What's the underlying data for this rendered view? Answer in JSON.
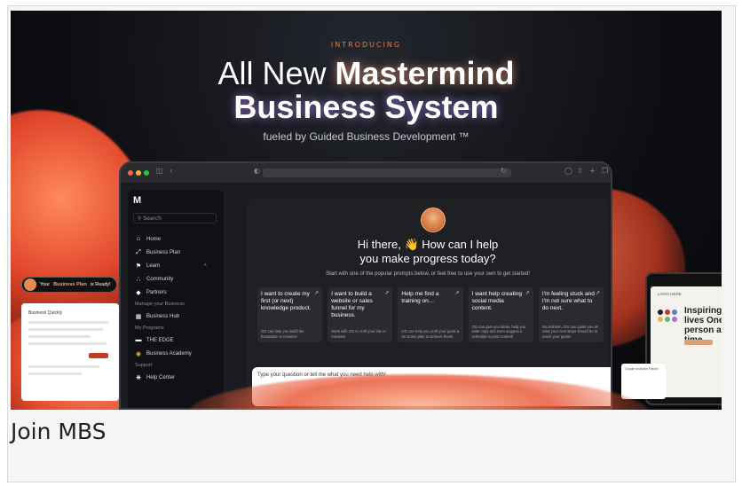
{
  "hero": {
    "introducing": "INTRODUCING",
    "title_line1_light": "All New ",
    "title_line1_bold": "Mastermind",
    "title_line2": "Business System",
    "tagline": "fueled by Guided Business Development ™"
  },
  "app": {
    "search_placeholder": "Search",
    "nav": [
      {
        "label": "Home",
        "icon": "home-icon",
        "glyph": "⌂"
      },
      {
        "label": "Business Plan",
        "icon": "expand-icon",
        "glyph": "⤢"
      },
      {
        "label": "Learn",
        "icon": "graduation-cap-icon",
        "glyph": "⚑"
      },
      {
        "label": "Community",
        "icon": "people-icon",
        "glyph": "∴"
      },
      {
        "label": "Partners",
        "icon": "diamond-icon",
        "glyph": "◆"
      }
    ],
    "section_manage": "Manage your Business",
    "business_hub": "Business Hub",
    "section_programs": "My Programs",
    "program_edge": "THE EDGE",
    "program_academy": "Business Academy",
    "section_support": "Support",
    "help_center": "Help Center",
    "greeting_line1": "Hi there, 👋 How can I help",
    "greeting_line2": "you make progress today?",
    "subtext": "Start with one of the popular prompts below, or feel free to use your own to get started!",
    "prompts": [
      {
        "title": "I want to create my first (or next) knowledge product.",
        "desc": "GG can help you build the foundation in minutes!"
      },
      {
        "title": "I want to build a website or sales funnel for my business.",
        "desc": "Work with GG to craft your site in minutes!"
      },
      {
        "title": "Help me find a training on…",
        "desc": "GG can help you craft your goals & an action plan to achieve them!"
      },
      {
        "title": "I want help creating social media content.",
        "desc": "GG can give you ideas, help you write copy and even suggest a schedule to post content!"
      },
      {
        "title": "I'm feeling stuck and I'm not sure what to do next.",
        "desc": "No problem, GG can guide you on what your next steps should be to reach your goals!"
      }
    ],
    "chat_placeholder": "Type your question or tell me what you need help with!"
  },
  "floating": {
    "pill_prefix": "Your ",
    "pill_bold": "Business Plan",
    "pill_suffix": " is Ready!",
    "left_doc_title": "Business Quickly",
    "tablet_logo": "LOGO HERE",
    "tablet_heading": "Inspiring lives One person at a time.",
    "tablet_card_title": "Google Analytics Report"
  },
  "caption": "Join MBS",
  "colors": {
    "accent": "#e24a2c",
    "background": "#0d0e12"
  }
}
